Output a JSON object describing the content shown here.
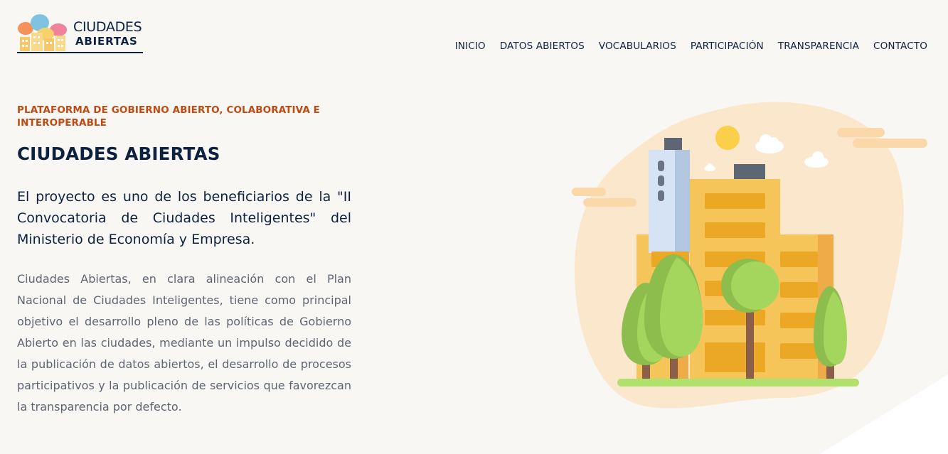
{
  "brand": {
    "line1": "CIUDADES",
    "line2": "ABIERTAS"
  },
  "nav": {
    "items": [
      {
        "label": "INICIO"
      },
      {
        "label": "DATOS ABIERTOS"
      },
      {
        "label": "VOCABULARIOS"
      },
      {
        "label": "PARTICIPACIÓN"
      },
      {
        "label": "TRANSPARENCIA"
      },
      {
        "label": "CONTACTO"
      }
    ]
  },
  "hero": {
    "eyebrow": "PLATAFORMA DE GOBIERNO ABIERTO, COLABORATIVA E INTEROPERABLE",
    "title": "CIUDADES ABIERTAS",
    "lead": "El proyecto es uno de los beneficiarios de la \"II Convocatoria de Ciudades Inteligentes\" del Ministerio de Economía y Empresa.",
    "body": "Ciudades Abiertas, en clara alineación con el Plan Nacional de Ciudades Inteligentes, tiene como principal objetivo el desarrollo pleno de las políticas de Gobierno Abierto en las ciudades, mediante un impulso decidido de la publicación de datos abiertos, el desarrollo de procesos participativos y la publicación de servicios que favorezcan la transparencia por defecto."
  },
  "colors": {
    "accent": "#c24a12",
    "navy": "#0d2140",
    "background": "#f9f7f4",
    "body_text": "#5d6573"
  },
  "icons": {
    "logo": "speech-bubbles-city-logo",
    "illustration": "city-buildings-trees-illustration"
  }
}
